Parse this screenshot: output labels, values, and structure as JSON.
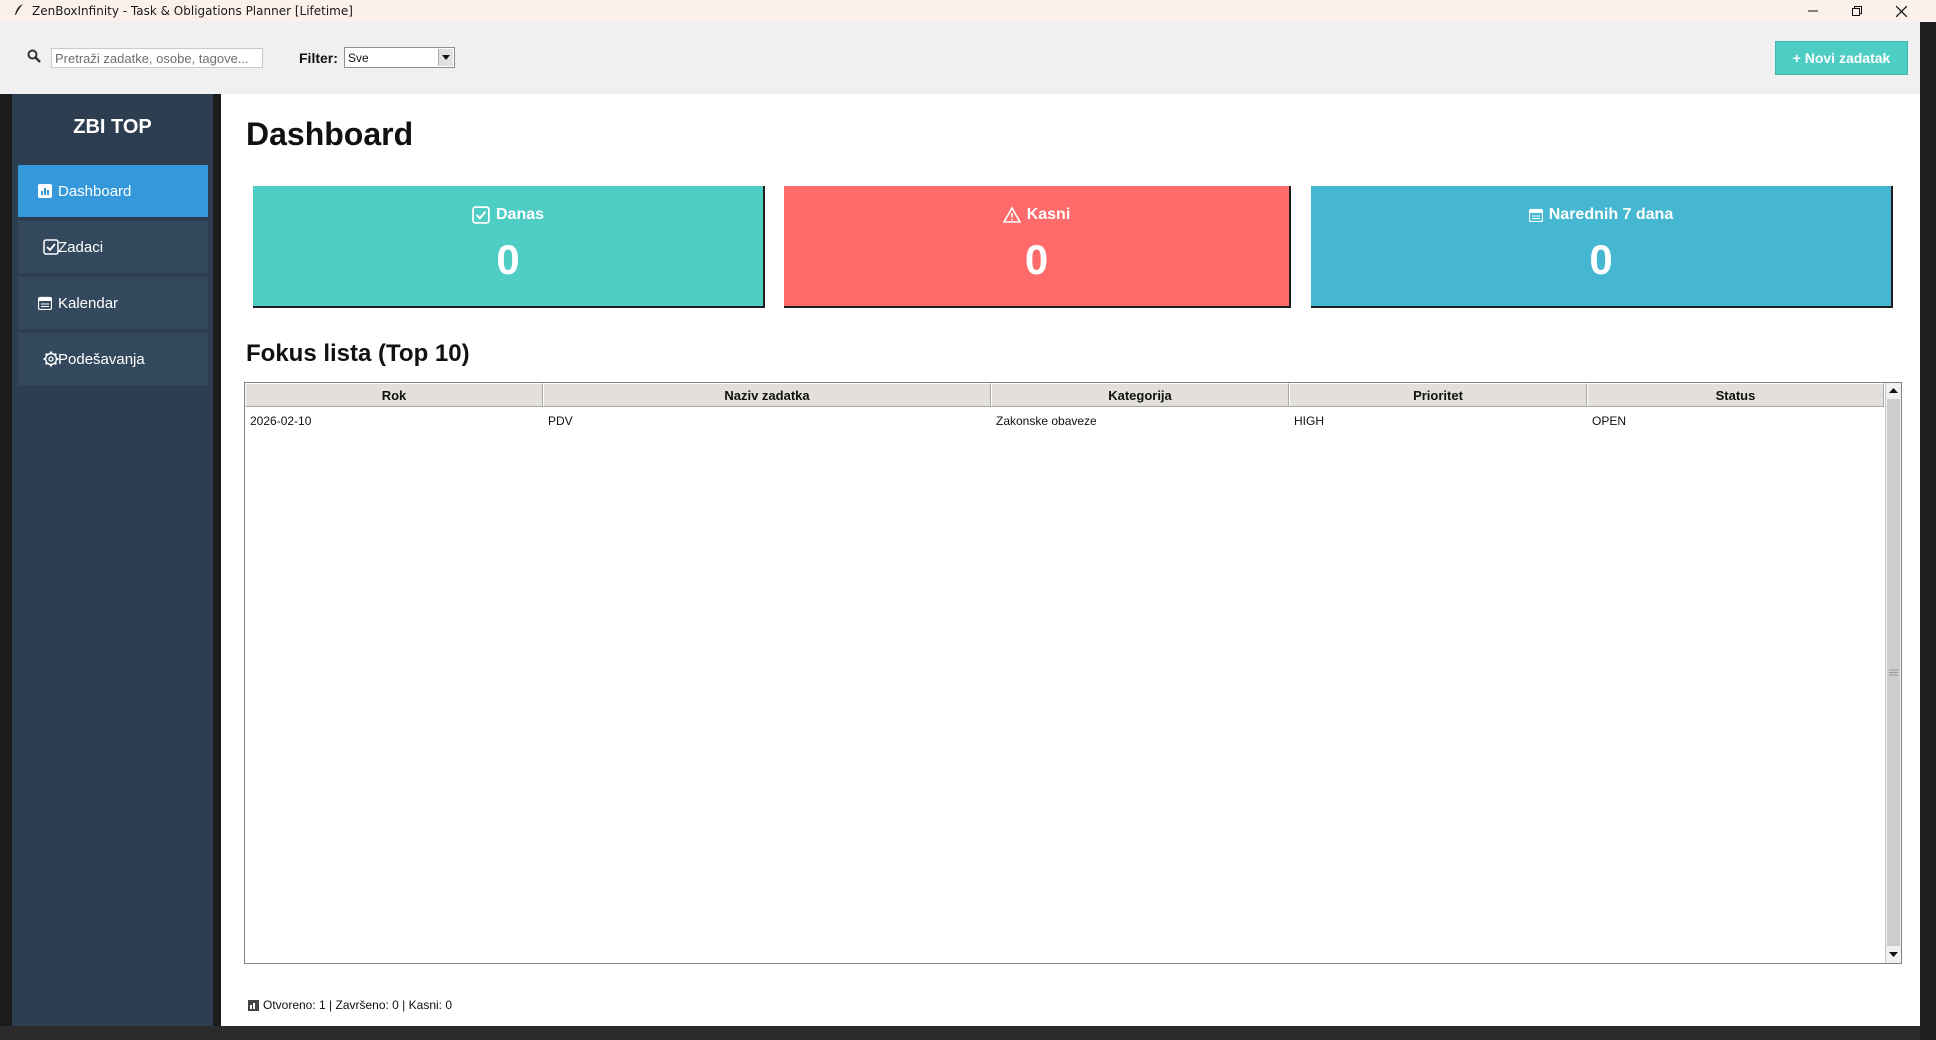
{
  "window": {
    "title": "ZenBoxInfinity - Task & Obligations Planner [Lifetime]",
    "controls": [
      "minimize-icon",
      "restore-icon",
      "close-icon"
    ]
  },
  "toolbar": {
    "search_placeholder": "Pretraži zadatke, osobe, tagove...",
    "filter_label": "Filter:",
    "filter_value": "Sve",
    "new_task_label": "+ Novi zadatak"
  },
  "sidebar": {
    "logo": "ZBI TOP",
    "items": [
      {
        "label": "Dashboard",
        "icon": "chart-icon",
        "active": true
      },
      {
        "label": "Zadaci",
        "icon": "checkbox-icon",
        "active": false
      },
      {
        "label": "Kalendar",
        "icon": "calendar-icon",
        "active": false
      },
      {
        "label": "Podešavanja",
        "icon": "gear-icon",
        "active": false
      }
    ]
  },
  "main": {
    "title": "Dashboard",
    "cards": [
      {
        "label": "Danas",
        "value": "0",
        "icon": "checkbox-icon",
        "color": "#4ecdc4"
      },
      {
        "label": "Kasni",
        "value": "0",
        "icon": "warning-icon",
        "color": "#ff6b6b"
      },
      {
        "label": "Narednih 7 dana",
        "value": "0",
        "icon": "calendar-icon",
        "color": "#45b7d1"
      }
    ],
    "focus_title": "Fokus lista (Top 10)",
    "table": {
      "columns": [
        "Rok",
        "Naziv zadatka",
        "Kategorija",
        "Prioritet",
        "Status"
      ],
      "rows": [
        [
          "2026-02-10",
          "PDV",
          "Zakonske obaveze",
          "HIGH",
          "OPEN"
        ]
      ]
    },
    "status_text": "Otvoreno: 1 | Završeno: 0 | Kasni: 0"
  },
  "colors": {
    "sidebar_bg": "#2c3e50",
    "nav_item_bg": "#34495e",
    "nav_active_bg": "#3498db",
    "accent": "#4ecdc4"
  }
}
